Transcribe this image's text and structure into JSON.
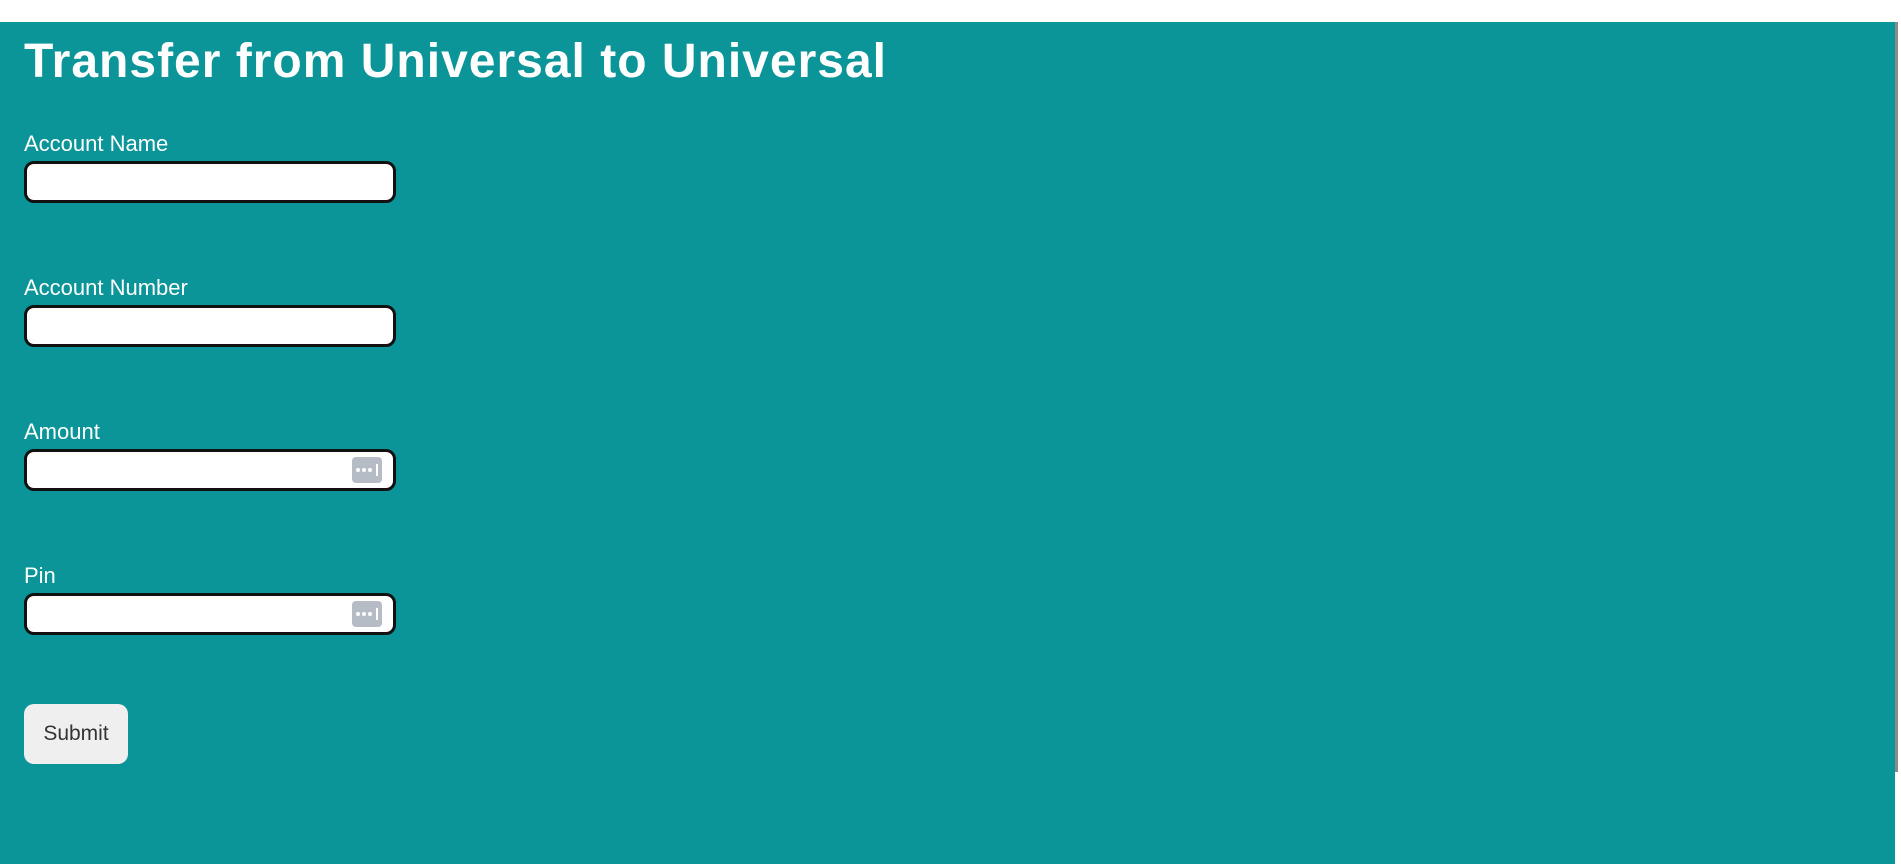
{
  "page": {
    "title": "Transfer from Universal to Universal",
    "background_color": "#0b9599"
  },
  "form": {
    "fields": [
      {
        "label": "Account Name",
        "value": "",
        "type": "text"
      },
      {
        "label": "Account Number",
        "value": "",
        "type": "text"
      },
      {
        "label": "Amount",
        "value": "",
        "type": "password",
        "icon": "password-manager-icon"
      },
      {
        "label": "Pin",
        "value": "",
        "type": "password",
        "icon": "password-manager-icon"
      }
    ],
    "submit_label": "Submit"
  }
}
